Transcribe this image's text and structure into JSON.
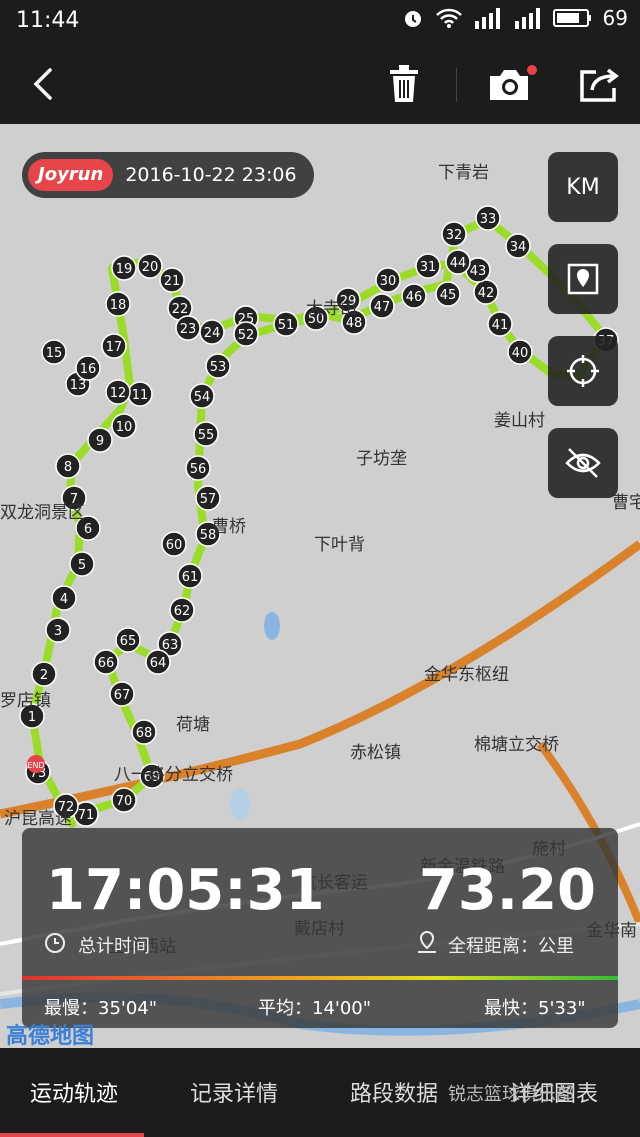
{
  "status": {
    "time": "11:44",
    "battery": "69"
  },
  "header": {
    "back_icon": "back-arrow-icon",
    "actions": [
      "trash-icon",
      "camera-icon",
      "share-icon"
    ]
  },
  "map": {
    "brand": "Joyrun",
    "datetime": "2016-10-22 23:06",
    "unit_button": "KM",
    "labels": [
      "下青岩",
      "姜山村",
      "子坊垄",
      "下叶背",
      "金华东枢纽",
      "棉塘立交桥",
      "赤松镇",
      "荷塘",
      "八一路分立交桥",
      "双龙洞景区",
      "罗店镇",
      "曹宅",
      "戴店村",
      "金华西站",
      "沪昆高速",
      "杭长客运",
      "新金温铁路",
      "施村",
      "金华南",
      "曹桥",
      "大寺山"
    ],
    "provider": "高德地图",
    "markers": [
      "1",
      "2",
      "3",
      "4",
      "5",
      "6",
      "7",
      "8",
      "9",
      "10",
      "11",
      "12",
      "13",
      "15",
      "16",
      "17",
      "18",
      "19",
      "20",
      "21",
      "22",
      "23",
      "24",
      "25",
      "29",
      "30",
      "31",
      "32",
      "33",
      "34",
      "37",
      "40",
      "41",
      "42",
      "43",
      "44",
      "45",
      "46",
      "47",
      "48",
      "50",
      "51",
      "52",
      "53",
      "54",
      "55",
      "56",
      "57",
      "58",
      "60",
      "61",
      "62",
      "63",
      "64",
      "65",
      "66",
      "67",
      "68",
      "69",
      "70",
      "71",
      "72",
      "73"
    ],
    "end_label": "END"
  },
  "stats": {
    "total_time": "17:05:31",
    "total_time_label": "总计时间",
    "distance": "73.20",
    "distance_label": "全程距离：公里",
    "slowest_label": "最慢：",
    "slowest": "35'04\"",
    "avg_label": "平均：",
    "avg": "14'00\"",
    "fastest_label": "最快：",
    "fastest": "5'33\""
  },
  "tabs": [
    "运动轨迹",
    "记录详情",
    "路段数据",
    "详细图表"
  ],
  "watermark": "锐志篮球俱乐部",
  "colors": {
    "accent": "#e8454b",
    "track_fast": "#7ed321",
    "track_slow": "#f5a623",
    "road": "#d9822b"
  }
}
